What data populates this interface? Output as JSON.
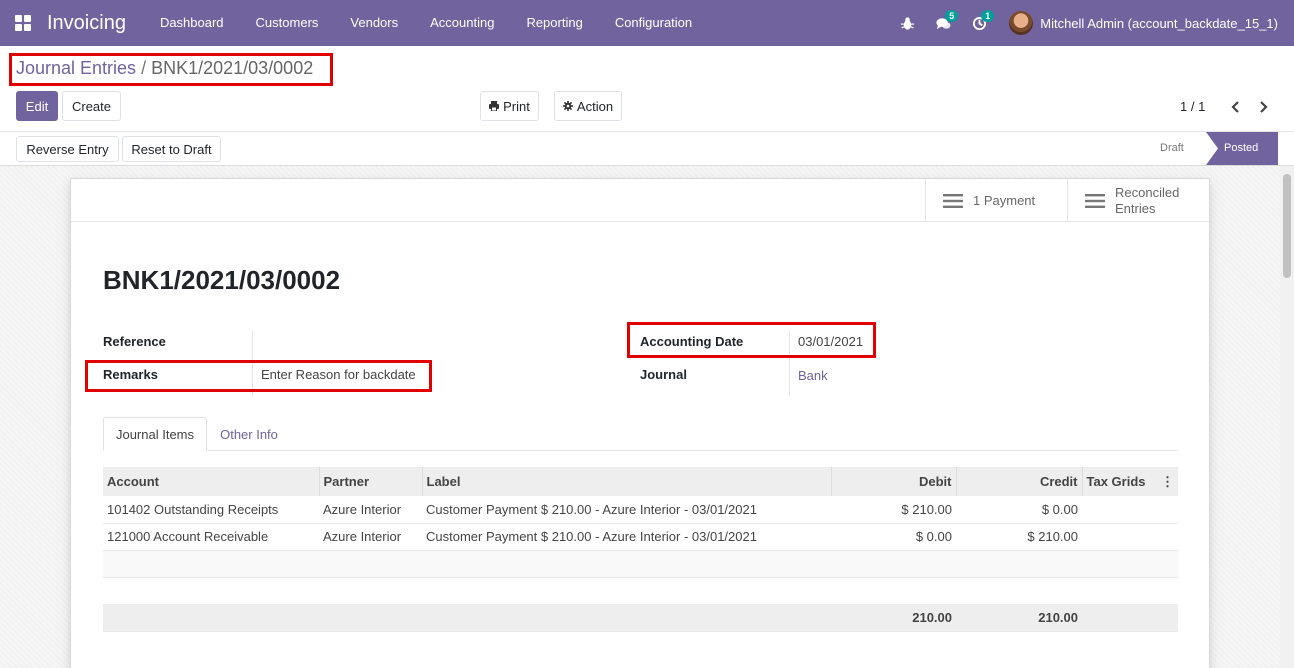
{
  "nav": {
    "app_name": "Invoicing",
    "menu": [
      "Dashboard",
      "Customers",
      "Vendors",
      "Accounting",
      "Reporting",
      "Configuration"
    ],
    "messages_badge": "5",
    "activities_badge": "1",
    "user": "Mitchell Admin (account_backdate_15_1)"
  },
  "breadcrumb": {
    "parent": "Journal Entries",
    "separator": "/",
    "current": "BNK1/2021/03/0002"
  },
  "controls": {
    "edit": "Edit",
    "create": "Create",
    "print": "Print",
    "action": "Action",
    "pager": "1 / 1"
  },
  "header_buttons": {
    "reverse": "Reverse Entry",
    "reset": "Reset to Draft"
  },
  "status": {
    "draft": "Draft",
    "posted": "Posted"
  },
  "smart_buttons": {
    "payment": "1 Payment",
    "reconciled_line1": "Reconciled",
    "reconciled_line2": "Entries"
  },
  "record": {
    "title": "BNK1/2021/03/0002",
    "reference_label": "Reference",
    "reference_value": "",
    "remarks_label": "Remarks",
    "remarks_placeholder": "Enter Reason for backdate",
    "accounting_date_label": "Accounting Date",
    "accounting_date": "03/01/2021",
    "journal_label": "Journal",
    "journal": "Bank"
  },
  "tabs": {
    "journal_items": "Journal Items",
    "other_info": "Other Info"
  },
  "table": {
    "headers": [
      "Account",
      "Partner",
      "Label",
      "Debit",
      "Credit",
      "Tax Grids"
    ],
    "rows": [
      [
        "101402 Outstanding Receipts",
        "Azure Interior",
        "Customer Payment $ 210.00 - Azure Interior - 03/01/2021",
        "$ 210.00",
        "$ 0.00",
        ""
      ],
      [
        "121000 Account Receivable",
        "Azure Interior",
        "Customer Payment $ 210.00 - Azure Interior - 03/01/2021",
        "$ 0.00",
        "$ 210.00",
        ""
      ]
    ],
    "total_debit": "210.00",
    "total_credit": "210.00"
  },
  "colors": {
    "brand": "#71639e",
    "highlight": "#e00000",
    "badge": "#00a09d"
  }
}
